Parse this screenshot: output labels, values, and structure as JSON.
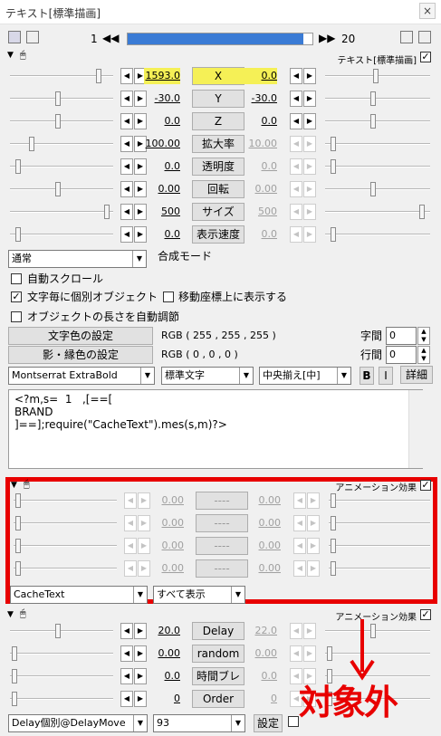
{
  "window": {
    "title": "テキスト[標準描画]",
    "close": "×"
  },
  "timeline": {
    "start": "1",
    "end": "20",
    "progress": 0.95
  },
  "text_section": {
    "name": "テキスト[標準描画]",
    "checked": true
  },
  "params": [
    {
      "name": "X",
      "left": "1593.0",
      "right": "0.0",
      "pos_l": 0.9,
      "pos_r": 0.5,
      "right_dim": false,
      "hl": true
    },
    {
      "name": "Y",
      "left": "-30.0",
      "right": "-30.0",
      "pos_l": 0.47,
      "pos_r": 0.47,
      "right_dim": false
    },
    {
      "name": "Z",
      "left": "0.0",
      "right": "0.0",
      "pos_l": 0.47,
      "pos_r": 0.47,
      "right_dim": false
    },
    {
      "name": "拡大率",
      "left": "100.00",
      "right": "10.00",
      "pos_l": 0.2,
      "pos_r": 0.06,
      "right_dim": true
    },
    {
      "name": "透明度",
      "left": "0.0",
      "right": "0.0",
      "pos_l": 0.06,
      "pos_r": 0.06,
      "right_dim": true
    },
    {
      "name": "回転",
      "left": "0.00",
      "right": "0.00",
      "pos_l": 0.47,
      "pos_r": 0.47,
      "right_dim": true
    },
    {
      "name": "サイズ",
      "left": "500",
      "right": "500",
      "pos_l": 0.98,
      "pos_r": 0.98,
      "right_dim": true
    },
    {
      "name": "表示速度",
      "left": "0.0",
      "right": "0.0",
      "pos_l": 0.06,
      "pos_r": 0.06,
      "right_dim": true
    }
  ],
  "blend": {
    "value": "通常",
    "label": "合成モード"
  },
  "options": {
    "auto_scroll": "自動スクロール",
    "per_char": "文字毎に個別オブジェクト",
    "move_on_coord": "移動座標上に表示する",
    "auto_length": "オブジェクトの長さを自動調節"
  },
  "color": {
    "text_btn": "文字色の設定",
    "text_rgb": "RGB ( 255 , 255 , 255 )",
    "shadow_btn": "影・縁色の設定",
    "shadow_rgb": "RGB ( 0 , 0 , 0 )",
    "char_space_label": "字間",
    "char_space": "0",
    "line_space_label": "行間",
    "line_space": "0"
  },
  "font": {
    "family": "Montserrat ExtraBold",
    "style": "標準文字",
    "align": "中央揃え[中]",
    "bold": "B",
    "italic": "I",
    "detail": "詳細"
  },
  "text_content": "<?m,s=  1   ,[==[\nBRAND\n]==];require(\"CacheText\").mes(s,m)?>",
  "anim1": {
    "name": "アニメーション効果",
    "type": "CacheText",
    "show": "すべて表示",
    "rows": [
      {
        "name": "----",
        "left": "0.00",
        "right": "0.00"
      },
      {
        "name": "----",
        "left": "0.00",
        "right": "0.00"
      },
      {
        "name": "----",
        "left": "0.00",
        "right": "0.00"
      },
      {
        "name": "----",
        "left": "0.00",
        "right": "0.00"
      }
    ]
  },
  "anim2": {
    "name": "アニメーション効果",
    "type": "Delay個別@DelayMove",
    "value": "93",
    "setting": "設定",
    "rows": [
      {
        "name": "Delay",
        "left": "20.0",
        "right": "22.0",
        "pos_l": 0.47,
        "pos_r": 0.47
      },
      {
        "name": "random",
        "left": "0.00",
        "right": "0.00",
        "pos_l": 0.02,
        "pos_r": 0.02
      },
      {
        "name": "時間ブレ",
        "left": "0.0",
        "right": "0.0",
        "pos_l": 0.02,
        "pos_r": 0.02
      },
      {
        "name": "Order",
        "left": "0",
        "right": "0",
        "pos_l": 0.02,
        "pos_r": 0.02
      }
    ]
  },
  "annotation": "対象外",
  "colors": {
    "highlight": "#f5f056",
    "red": "#e80000",
    "timeline": "#3a7bd5"
  }
}
